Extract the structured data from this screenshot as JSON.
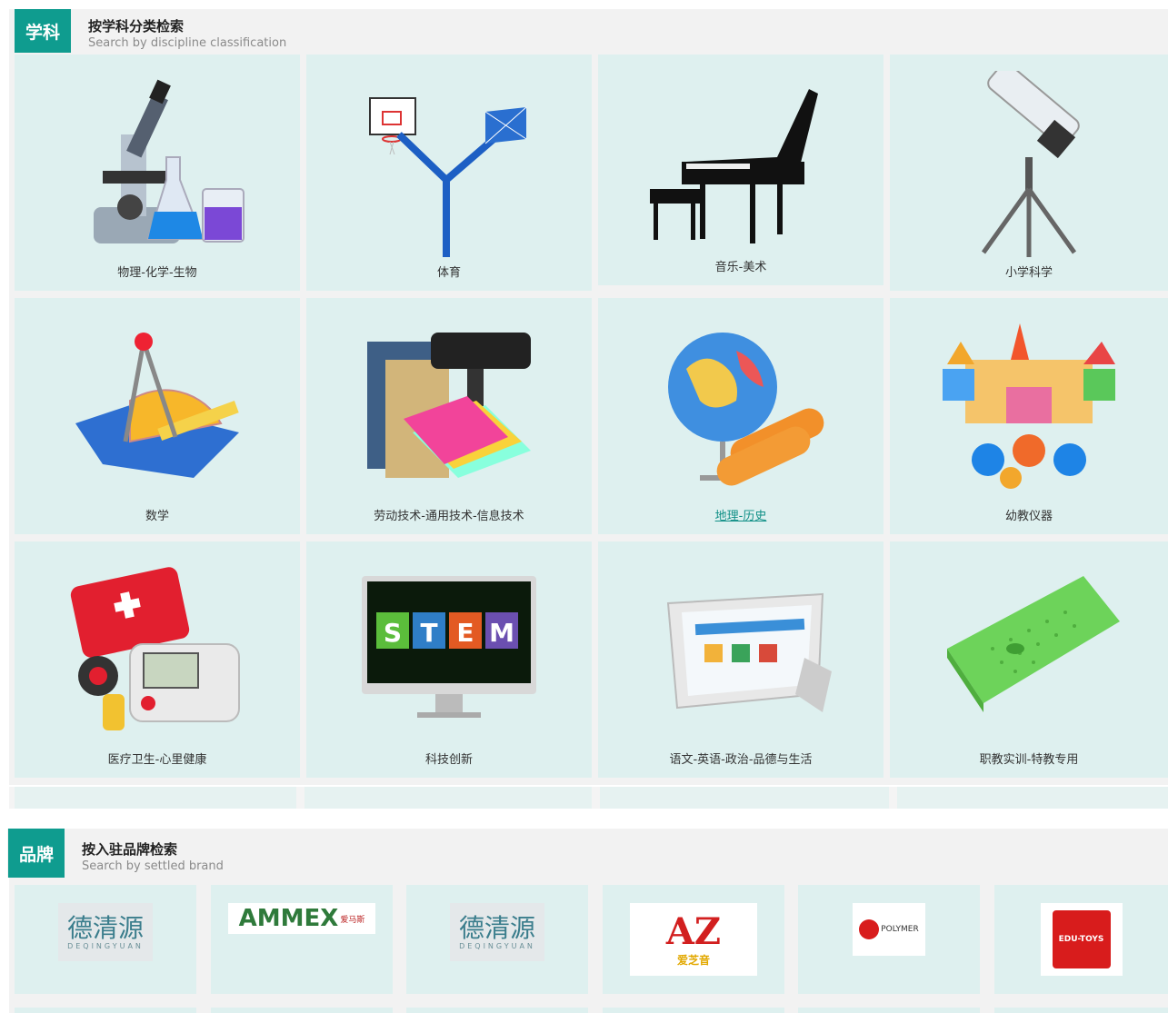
{
  "subject_section": {
    "tag": "学科",
    "title": "按学科分类检索",
    "subtitle": "Search by discipline classification",
    "items": [
      {
        "label": "物理-化学-生物",
        "icon": "microscope-flask-icon"
      },
      {
        "label": "体育",
        "icon": "basketball-hoop-icon"
      },
      {
        "label": "音乐-美术",
        "icon": "piano-icon"
      },
      {
        "label": "小学科学",
        "icon": "telescope-icon"
      },
      {
        "label": "数学",
        "icon": "compass-ruler-icon"
      },
      {
        "label": "劳动技术-通用技术-信息技术",
        "icon": "workbench-paper-icon"
      },
      {
        "label": "地理-历史",
        "icon": "globe-scroll-icon"
      },
      {
        "label": "幼教仪器",
        "icon": "toy-blocks-icon"
      },
      {
        "label": "医疗卫生-心里健康",
        "icon": "first-aid-kit-icon"
      },
      {
        "label": "科技创新",
        "icon": "stem-monitor-icon"
      },
      {
        "label": "语文-英语-政治-品德与生活",
        "icon": "tablet-icon"
      },
      {
        "label": "职教实训-特教专用",
        "icon": "braille-board-icon"
      }
    ]
  },
  "brand_section": {
    "tag": "品牌",
    "title": "按入驻品牌检索",
    "subtitle": "Search by settled brand",
    "brands": [
      {
        "name": "德清源",
        "sub": "DEQINGYUAN",
        "icon": "deqingyuan-logo"
      },
      {
        "name": "AMMEX",
        "sub": "爱马斯",
        "icon": "ammex-logo"
      },
      {
        "name": "德清源",
        "sub": "DEQINGYUAN",
        "icon": "deqingyuan-logo"
      },
      {
        "name": "AZ",
        "sub": "爱芝音",
        "icon": "az-logo"
      },
      {
        "name": "POLYMER",
        "sub": "",
        "icon": "polymer-logo"
      },
      {
        "name": "EDU-TOYS",
        "sub": "",
        "icon": "edu-toys-logo"
      }
    ]
  },
  "colors": {
    "accent": "#0f9c8f",
    "card_bg": "#def0ef",
    "section_bg": "#f2f2f2"
  }
}
